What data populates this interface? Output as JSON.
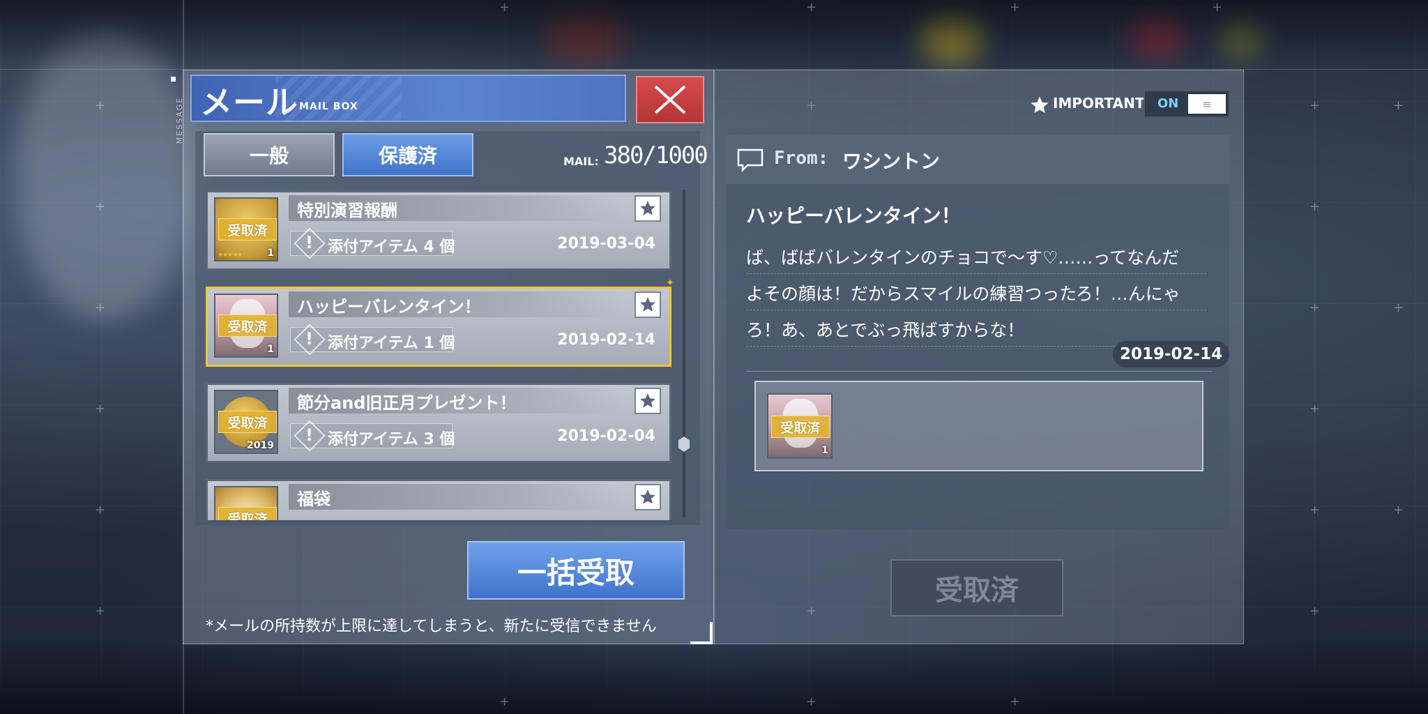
{
  "header": {
    "title": "メール",
    "subtitle": "MAIL BOX",
    "side_label": "MESSAGE"
  },
  "tabs": [
    {
      "label": "一般",
      "active": false
    },
    {
      "label": "保護済",
      "active": true
    }
  ],
  "mail_count": {
    "label": "MAIL:",
    "value": "380/1000"
  },
  "mails": [
    {
      "title": "特別演習報酬",
      "attachment": "添付アイテム 4 個",
      "date": "2019-03-04",
      "badge": "受取済",
      "thumb_num": "1",
      "thumb": "gold-stars-icon",
      "selected": false
    },
    {
      "title": "ハッピーバレンタイン！",
      "attachment": "添付アイテム 1 個",
      "date": "2019-02-14",
      "badge": "受取済",
      "thumb_num": "1",
      "thumb": "character-portrait-icon",
      "selected": true
    },
    {
      "title": "節分and旧正月プレゼント！",
      "attachment": "添付アイテム 3 個",
      "date": "2019-02-04",
      "badge": "受取済",
      "thumb_num": "2019",
      "thumb": "gold-coin-icon",
      "selected": false
    },
    {
      "title": "福袋",
      "attachment": "",
      "date": "",
      "badge": "受取済",
      "thumb_num": "",
      "thumb": "lucky-bag-icon",
      "selected": false
    }
  ],
  "bulk_button": "一括受取",
  "notice": "*メールの所持数が上限に達してしまうと、新たに受信できません",
  "important": {
    "label": "IMPORTANT",
    "toggle": "ON",
    "knob": "≡"
  },
  "detail": {
    "from_label": "From:",
    "from_name": "ワシントン",
    "title": "ハッピーバレンタイン！",
    "lines": [
      "ば、ばばバレンタインのチョコで〜す♡……ってなんだ",
      "よその顔は！だからスマイルの練習つったろ！…んにゃ",
      "ろ！あ、あとでぶっ飛ばすからな！"
    ],
    "date": "2019-02-14",
    "attachment_badge": "受取済",
    "attachment_num": "1",
    "claimed_button": "受取済"
  },
  "colors": {
    "accent_blue": "#4f7cd0",
    "close_red": "#c94040",
    "selected_gold": "#f2c530",
    "badge_gold": "#e2b230"
  }
}
